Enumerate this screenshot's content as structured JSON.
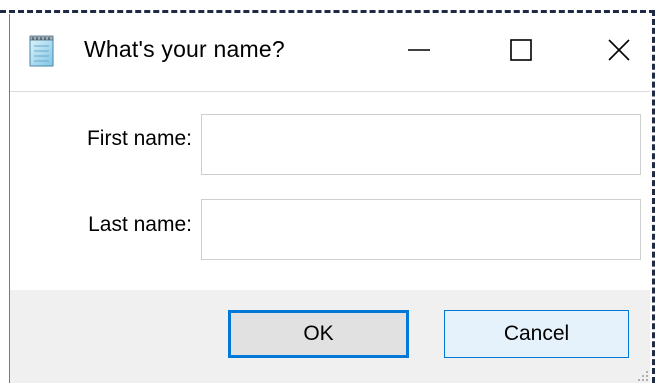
{
  "window": {
    "title": "What's your name?",
    "icon": "notepad-icon",
    "controls": {
      "minimize": "minimize-icon",
      "maximize": "maximize-icon",
      "close": "close-icon"
    }
  },
  "form": {
    "first_name_label": "First name:",
    "first_name_value": "",
    "last_name_label": "Last name:",
    "last_name_value": ""
  },
  "buttons": {
    "ok_label": "OK",
    "cancel_label": "Cancel"
  },
  "colors": {
    "accent": "#0078d7",
    "footer_bg": "#f0f0f0",
    "cancel_bg": "#e5f1fb"
  }
}
